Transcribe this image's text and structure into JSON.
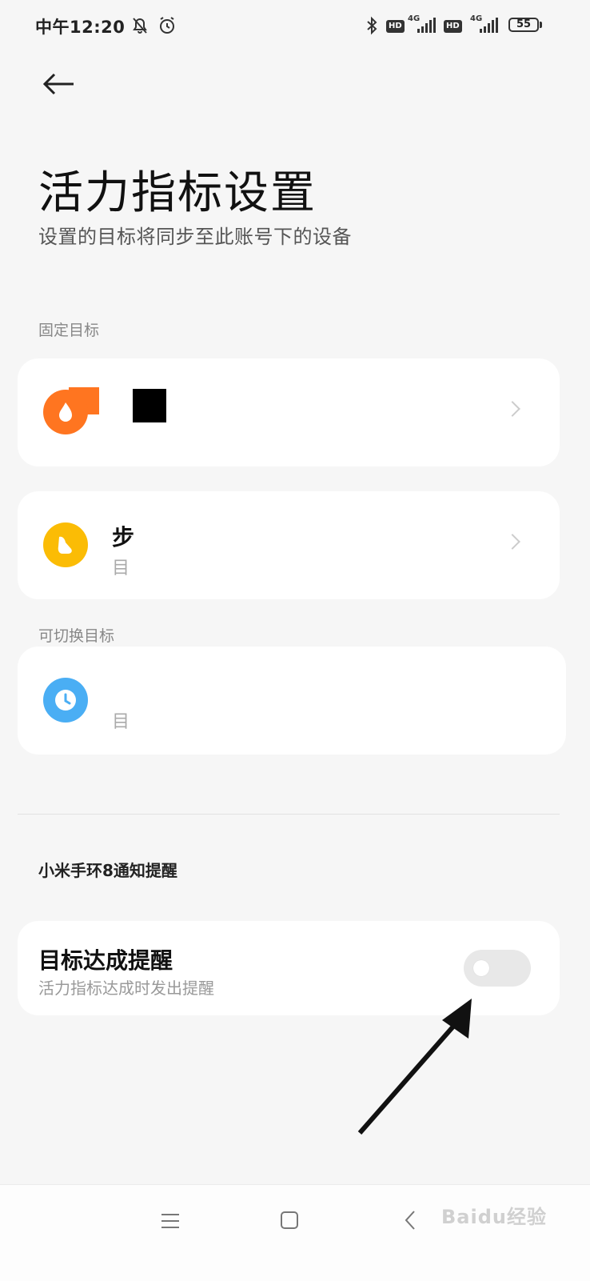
{
  "status_bar": {
    "time": "中午12:20",
    "network_1": "4G",
    "network_2": "4G",
    "hd_badge": "HD",
    "battery": "55"
  },
  "header": {
    "title": "活力指标设置",
    "subtitle": "设置的目标将同步至此账号下的设备"
  },
  "sections": {
    "fixed_label": "固定目标",
    "switchable_label": "可切换目标",
    "notify_label": "小米手环8通知提醒"
  },
  "goals": {
    "steps_fragment": "步",
    "steps_sub_fragment": "目",
    "duration_sub_fragment": "目"
  },
  "reminder": {
    "title": "目标达成提醒",
    "description": "活力指标达成时发出提醒",
    "enabled": false
  },
  "watermark": "Baidu经验",
  "colors": {
    "calories_icon": "#ff7520",
    "steps_icon": "#fbbc05",
    "duration_icon": "#4aaef4",
    "background": "#f6f6f6"
  },
  "icons": [
    "back-arrow-icon",
    "flame-icon",
    "shoe-icon",
    "clock-icon",
    "chevron-right-icon",
    "menu-icon",
    "home-square-icon",
    "back-chevron-icon"
  ]
}
